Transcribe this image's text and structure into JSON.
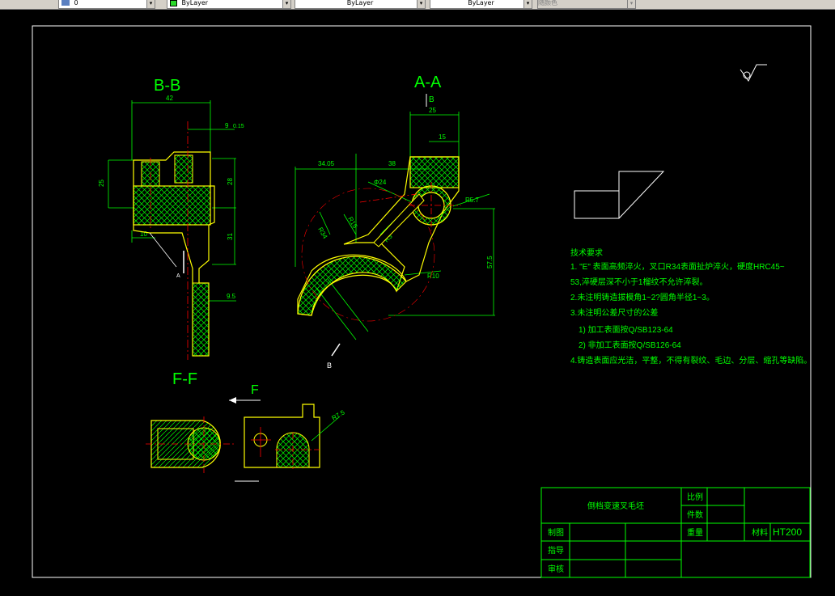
{
  "toolbar": {
    "layer_name": "0",
    "color": "ByLayer",
    "linetype": "ByLayer",
    "lineweight": "ByLayer",
    "plotstyle": "随颜色"
  },
  "views": {
    "bb": "B-B",
    "aa": "A-A",
    "ff": "F-F",
    "f_arrow": "F",
    "a_mark": "A",
    "b_mark": "B",
    "b_section_top": "B"
  },
  "dims": {
    "d42": "42",
    "d9": "9",
    "d015": "0.15",
    "d25v": "25",
    "d28": "28",
    "d31": "31",
    "d10": "10",
    "d95": "9.5",
    "d25h": "25",
    "d15": "15",
    "d34": "34.05",
    "d38": "38",
    "d24": "Φ24",
    "dR57": "R5.7",
    "dR34": "R34",
    "dR15": "R15",
    "dR3": "R3",
    "dR10": "R10",
    "d575": "57.5",
    "dR75": "R7.5",
    "dR": "R"
  },
  "notes": {
    "title": "技术要求",
    "lines": [
      "1. \"E\" 表面高频淬火，叉口R34表面扯炉淬火，硬度HRC45~",
      "53,淬硬层深不小于1榴纹不允许淬裂。",
      "2.未注明铸造拔模角1~2?圆角半径1~3。",
      "3.未注明公差尺寸的公差",
      "1) 加工表面按Q/SB123-64",
      "2) 非加工表面按Q/SB126-64",
      "4.铸造表面应光洁，平整，不得有裂纹、毛边、分层、缩孔等缺陷。"
    ]
  },
  "title_block": {
    "part_name": "倒档变速叉毛坯",
    "scale_label": "比例",
    "qty_label": "件数",
    "weight_label": "重量",
    "material_label": "材料",
    "material_value": "HT200",
    "drawn_label": "制图",
    "guide_label": "指导",
    "check_label": "审核"
  },
  "colors": {
    "frame": "#ffffff",
    "part": "#ffff00",
    "dimension": "#00ff00",
    "center": "#ff0000",
    "hatch": "#00ff00",
    "text": "#00ff00"
  }
}
